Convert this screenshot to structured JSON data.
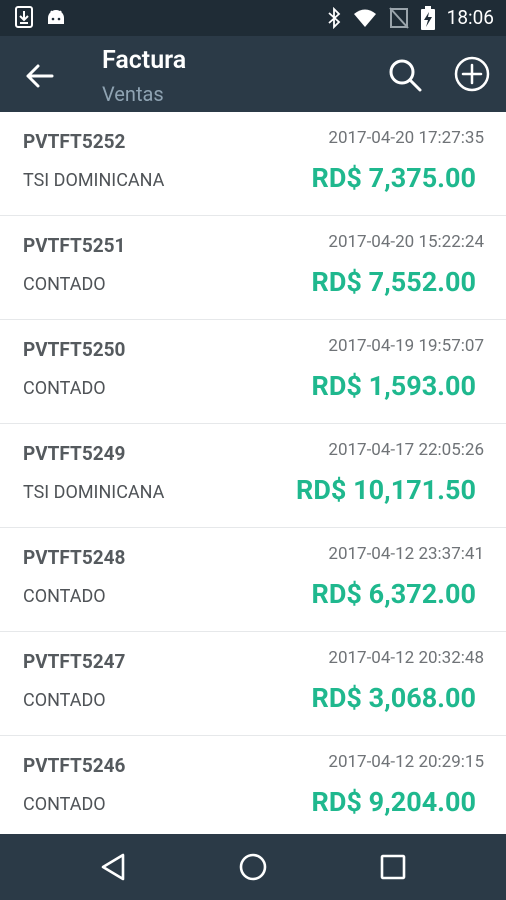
{
  "status_bar": {
    "time": "18:06",
    "icons": [
      "download-icon",
      "android-icon",
      "bluetooth-icon",
      "wifi-icon",
      "no-sim-icon",
      "battery-charging-icon"
    ]
  },
  "app_bar": {
    "title": "Factura",
    "subtitle": "Ventas",
    "icons": [
      "back-arrow-icon",
      "search-icon",
      "add-circle-icon"
    ]
  },
  "invoices": [
    {
      "code": "PVTFT5252",
      "date": "2017-04-20 17:27:35",
      "client": "TSI DOMINICANA",
      "amount": "RD$ 7,375.00"
    },
    {
      "code": "PVTFT5251",
      "date": "2017-04-20 15:22:24",
      "client": "CONTADO",
      "amount": "RD$ 7,552.00"
    },
    {
      "code": "PVTFT5250",
      "date": "2017-04-19 19:57:07",
      "client": "CONTADO",
      "amount": "RD$ 1,593.00"
    },
    {
      "code": "PVTFT5249",
      "date": "2017-04-17 22:05:26",
      "client": "TSI DOMINICANA",
      "amount": "RD$ 10,171.50"
    },
    {
      "code": "PVTFT5248",
      "date": "2017-04-12 23:37:41",
      "client": "CONTADO",
      "amount": "RD$ 6,372.00"
    },
    {
      "code": "PVTFT5247",
      "date": "2017-04-12 20:32:48",
      "client": "CONTADO",
      "amount": "RD$ 3,068.00"
    },
    {
      "code": "PVTFT5246",
      "date": "2017-04-12 20:29:15",
      "client": "CONTADO",
      "amount": "RD$ 9,204.00"
    }
  ],
  "nav_bar": {
    "icons": [
      "back-triangle-icon",
      "home-circle-icon",
      "recents-square-icon"
    ]
  },
  "colors": {
    "status_bar": "#1f2c36",
    "app_bar": "#2b3a47",
    "amount": "#1fb88e",
    "subtitle": "#8fa3b2"
  }
}
